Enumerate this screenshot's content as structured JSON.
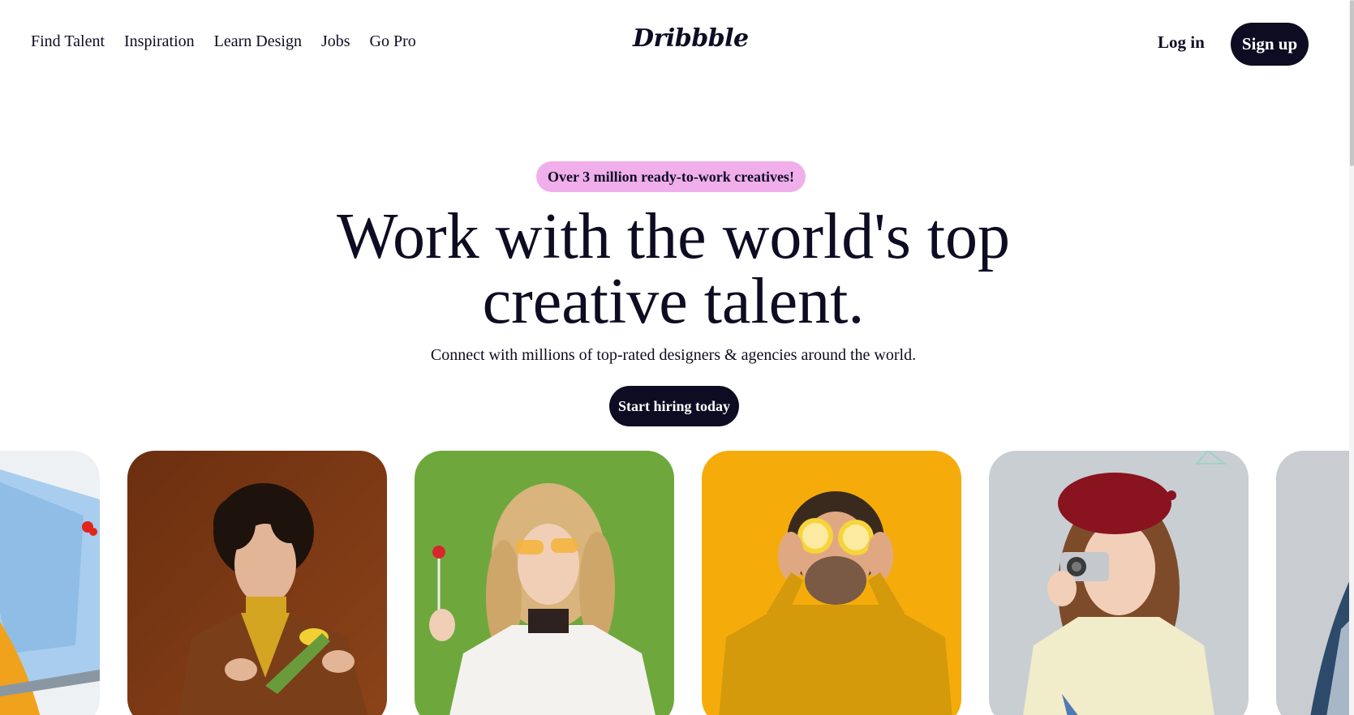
{
  "header": {
    "nav": [
      {
        "label": "Find Talent"
      },
      {
        "label": "Inspiration"
      },
      {
        "label": "Learn Design"
      },
      {
        "label": "Jobs"
      },
      {
        "label": "Go Pro"
      }
    ],
    "logo": "Dribbble",
    "login_label": "Log in",
    "signup_label": "Sign up"
  },
  "hero": {
    "badge": "Over 3 million ready-to-work creatives!",
    "title_line1": "Work with the world's top",
    "title_line2": "creative talent.",
    "subtitle": "Connect with millions of top-rated designers & agencies around the world.",
    "cta_label": "Start hiring today"
  },
  "colors": {
    "badge_bg": "#f0aeeb",
    "dark": "#0d0c22",
    "card_brown": "#7a3a14",
    "card_green": "#6ea83c",
    "card_yellow": "#f5ac0a",
    "card_grey": "#c9ced2"
  },
  "cards": [
    {
      "icon": "blue-illustration-image"
    },
    {
      "icon": "portrait-man-tulip-image"
    },
    {
      "icon": "portrait-woman-lollipop-image"
    },
    {
      "icon": "portrait-man-lemons-image"
    },
    {
      "icon": "portrait-woman-camera-image"
    },
    {
      "icon": "portrait-partial-image"
    }
  ]
}
